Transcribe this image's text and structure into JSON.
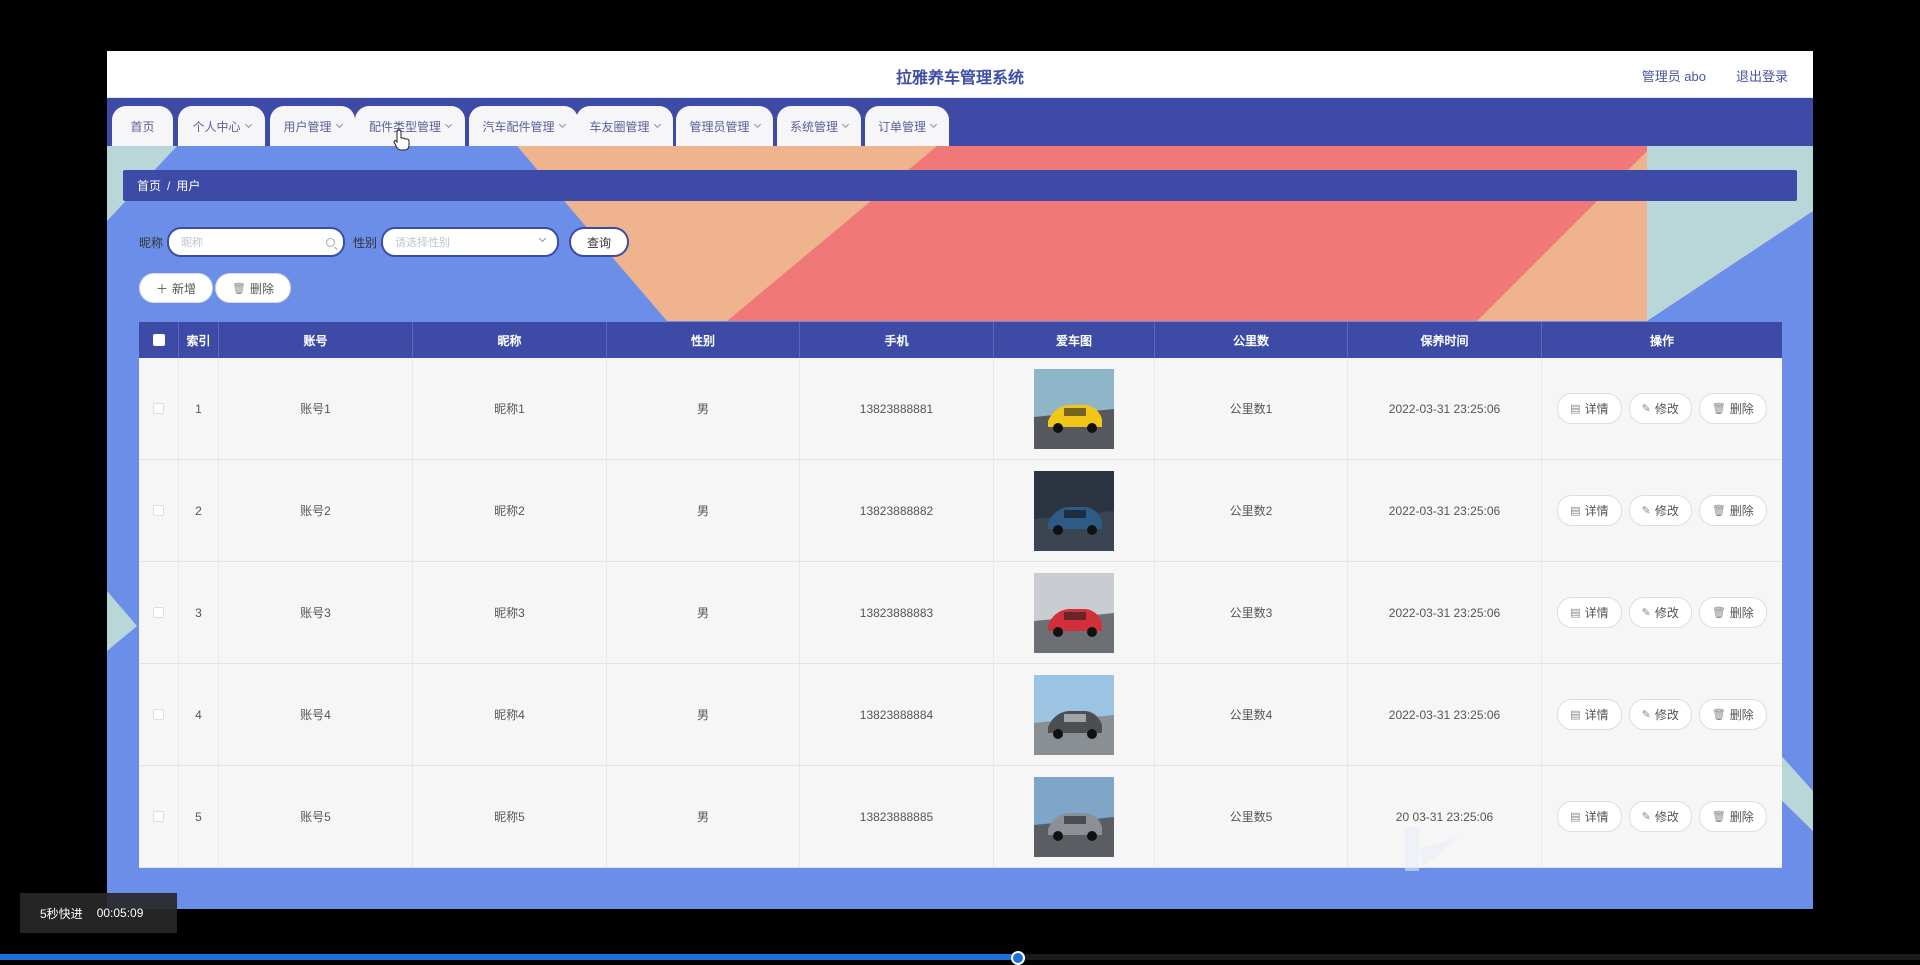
{
  "app": {
    "title": "拉雅养车管理系统",
    "user_label": "管理员 abo",
    "logout_label": "退出登录"
  },
  "nav": {
    "items": [
      {
        "label": "首页",
        "has_menu": false
      },
      {
        "label": "个人中心",
        "has_menu": true
      },
      {
        "label": "用户管理",
        "has_menu": true
      },
      {
        "label": "配件类型管理",
        "has_menu": true
      },
      {
        "label": "汽车配件管理",
        "has_menu": true
      },
      {
        "label": "车友圈管理",
        "has_menu": true
      },
      {
        "label": "管理员管理",
        "has_menu": true
      },
      {
        "label": "系统管理",
        "has_menu": true
      },
      {
        "label": "订单管理",
        "has_menu": true
      }
    ]
  },
  "breadcrumb": {
    "home": "首页",
    "sep": "/",
    "current": "用户"
  },
  "search": {
    "nickname_label": "昵称",
    "nickname_placeholder": "昵称",
    "gender_label": "性别",
    "gender_placeholder": "请选择性别",
    "query_label": "查询"
  },
  "actions": {
    "add_label": "新增",
    "delete_label": "删除"
  },
  "table": {
    "headers": [
      "",
      "索引",
      "账号",
      "昵称",
      "性别",
      "手机",
      "爱车图",
      "公里数",
      "保养时间",
      "操作"
    ],
    "op_labels": {
      "detail": "详情",
      "edit": "修改",
      "delete": "删除"
    },
    "rows": [
      {
        "index": "1",
        "account": "账号1",
        "nickname": "昵称1",
        "gender": "男",
        "phone": "13823888881",
        "car": "yellow-sports-car",
        "km": "公里数1",
        "time": "2022-03-31 23:25:06"
      },
      {
        "index": "2",
        "account": "账号2",
        "nickname": "昵称2",
        "gender": "男",
        "phone": "13823888882",
        "car": "dark-blue-suv",
        "km": "公里数2",
        "time": "2022-03-31 23:25:06"
      },
      {
        "index": "3",
        "account": "账号3",
        "nickname": "昵称3",
        "gender": "男",
        "phone": "13823888883",
        "car": "red-car-on-road",
        "km": "公里数3",
        "time": "2022-03-31 23:25:06"
      },
      {
        "index": "4",
        "account": "账号4",
        "nickname": "昵称4",
        "gender": "男",
        "phone": "13823888884",
        "car": "car-on-bridge",
        "km": "公里数4",
        "time": "2022-03-31 23:25:06"
      },
      {
        "index": "5",
        "account": "账号5",
        "nickname": "昵称5",
        "gender": "男",
        "phone": "13823888885",
        "car": "silver-sedan",
        "km": "公里数5",
        "time": "20  03-31 23:25:06"
      }
    ]
  },
  "player": {
    "skip_label": "5秒快进",
    "time": "00:05:09",
    "progress": 0.53
  },
  "colors": {
    "primary": "#3d4ba6",
    "bg_blue": "#6b8fe8",
    "peach": "#efb48e",
    "coral": "#f07878",
    "teal": "#b9d7d8"
  }
}
